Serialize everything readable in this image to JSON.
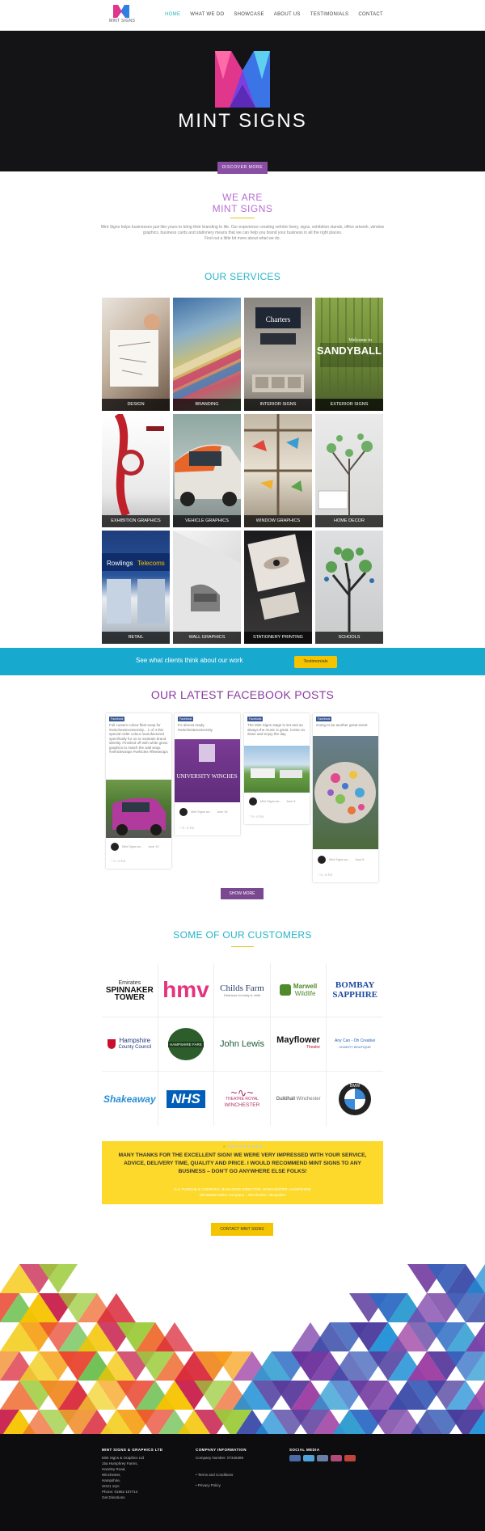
{
  "header": {
    "logo_text": "MINT SIGNS",
    "nav": [
      "HOME",
      "WHAT WE DO",
      "SHOWCASE",
      "ABOUT US",
      "TESTIMONIALS",
      "CONTACT"
    ],
    "active_index": 0
  },
  "hero": {
    "brand": "MINT SIGNS",
    "button": "DISCOVER MORE"
  },
  "intro": {
    "line1": "WE ARE",
    "line2": "MINT SIGNS",
    "paragraph": "Mint Signs helps businesses just like yours to bring their branding to life. Our experience creating vehicle livery, signs, exhibition stands, office artwork, window graphics, business cards and stationery means that we can help you brand your business in all the right places.",
    "find_out": "Find out a little bit more about what we do."
  },
  "services": {
    "title": "OUR SERVICES",
    "items": [
      "DESIGN",
      "BRANDING",
      "INTERIOR SIGNS",
      "EXTERIOR SIGNS",
      "EXHIBITION GRAPHICS",
      "VEHICLE GRAPHICS",
      "WINDOW GRAPHICS",
      "HOME DECOR",
      "RETAIL",
      "WALL GRAPHICS",
      "STATIONERY PRINTING",
      "SCHOOLS"
    ],
    "tile_labels": {
      "charters": "Charters",
      "sandyball_welcome": "Welcome to",
      "sandyball": "SANDYBALL",
      "rowlings": "Rowlings",
      "telecoms": "Telecoms"
    }
  },
  "clients_band": {
    "text": "See what clients think about our work",
    "button": "Testimonials"
  },
  "facebook": {
    "title": "OUR LATEST FACEBOOK POSTS",
    "badge": "Facebook",
    "posts": [
      {
        "text": "Full custom colour fleet wrap for #winchesteruniversity... 1 of 4 this special order colour manufactured specifically for us to maintain brand identity. Finished off with white gloss graphics to match the wall wrap. #vehiclewraps #vehicles #fleetwraps",
        "author": "Mint Signs an...",
        "time": "June 19",
        "likes": "0",
        "comments": "0",
        "shares": "0"
      },
      {
        "text": "It's almost ready. #winchesteruniversity",
        "image_label": "UNIVERSITY WINCHES",
        "author": "Mint Signs an...",
        "time": "June 18",
        "likes": "0",
        "comments": "4",
        "shares": "0"
      },
      {
        "text": "The Mint Signs stage is set and as always the music is great. Come on down and enjoy the day.",
        "author": "Mint Signs an...",
        "time": "June 8",
        "likes": "0",
        "comments": "0",
        "shares": "0"
      },
      {
        "text": "Going to be another great event",
        "author": "Mint Signs an...",
        "time": "June 8",
        "likes": "0",
        "comments": "0",
        "shares": "0"
      }
    ],
    "show_more": "SHOW MORE"
  },
  "customers": {
    "title": "SOME OF OUR CUSTOMERS",
    "logos": [
      {
        "line1": "Emirates",
        "line2": "SPINNAKER",
        "line3": "TOWER"
      },
      {
        "line1": "hmv"
      },
      {
        "line1": "Childs Farm",
        "line2": "Delicious for baby & child"
      },
      {
        "line1": "Marwell",
        "line2": "Wildlife"
      },
      {
        "line1": "BOMBAY",
        "line2": "SAPPHIRE"
      },
      {
        "line1": "Hampshire",
        "line2": "County Council"
      },
      {
        "line1": "HAMPSHIRE FARE"
      },
      {
        "line1": "John Lewis"
      },
      {
        "line1": "Mayflower",
        "line2": "Theatre"
      },
      {
        "line1": "Any Can - Oh Creative",
        "line2": "CHARITY BOUTIQUE"
      },
      {
        "line1": "Shakeaway"
      },
      {
        "line1": "NHS"
      },
      {
        "line1": "THEATRE ROYAL",
        "line2": "WINCHESTER"
      },
      {
        "line1": "Guildhall",
        "line2": "Winchester"
      },
      {
        "line1": "BMW"
      }
    ]
  },
  "testimonial": {
    "quote": "MANY THANKS FOR THE EXCELLENT SIGN! WE WERE VERY IMPRESSED WITH YOUR SERVICE, ADVICE, DELIVERY TIME, QUALITY AND PRICE. I WOULD RECOMMEND MINT SIGNS TO ANY BUSINESS – DON'T GO ANYWHERE ELSE FOLKS!",
    "source1": "N.V. PURDUE & COMPANY, MANAGING DIRECTOR, WINCHESTER, HAMPSHIRE",
    "source2": "Old Market Motor Company – Winchester, Hampshire",
    "dots": 10,
    "active_dot": 0
  },
  "contact_button": "CONTACT MINT SIGNS",
  "footer": {
    "col1_title": "MINT SIGNS & GRAPHICS LTD",
    "address": [
      "Mint Signs & Graphics Ltd",
      "15a Humphrey Farms,",
      "Hazeley Road,",
      "Winchester,",
      "Hampshire,",
      "SO21 1QA",
      "Phone: 01962 107714",
      "Get Directions"
    ],
    "col2_title": "COMPANY INFORMATION",
    "company_number": "Company Number: 07346389",
    "links": [
      "Terms and Conditions",
      "Privacy Policy"
    ],
    "col3_title": "SOCIAL MEDIA"
  }
}
